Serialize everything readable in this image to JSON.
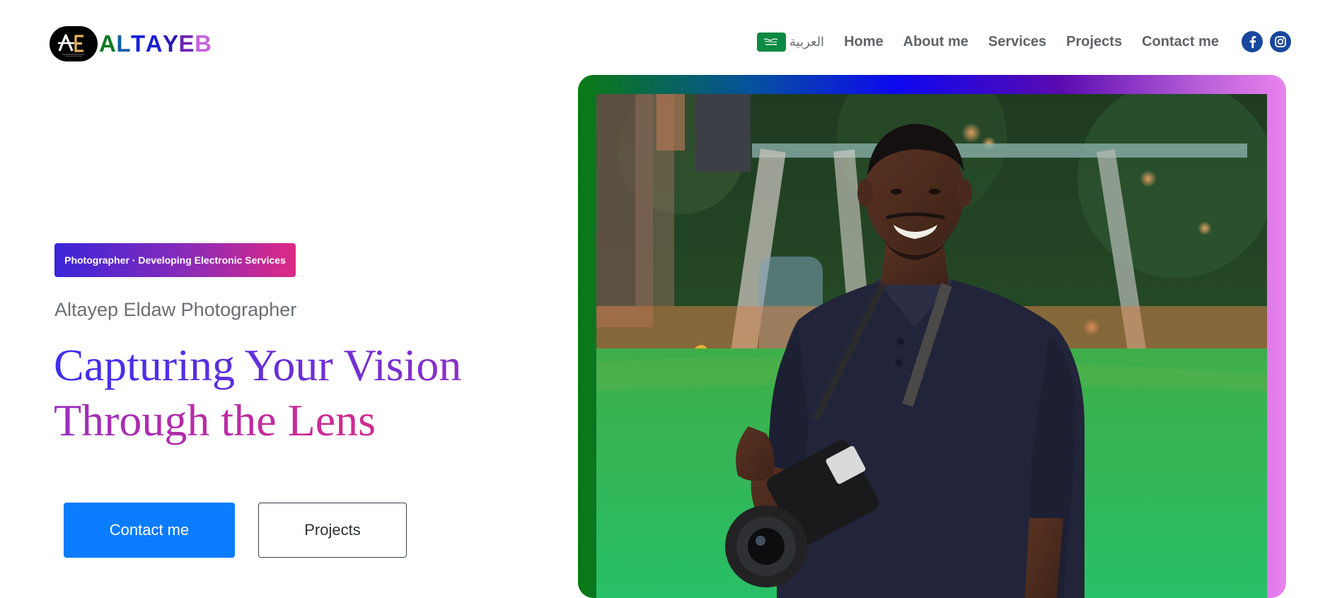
{
  "header": {
    "logo": {
      "badge_text": "AE",
      "word": "ALTAYEB",
      "word_letters": [
        {
          "ch": "A",
          "color": "#0b7a1f"
        },
        {
          "ch": "L",
          "color": "#0a5fa8"
        },
        {
          "ch": "T",
          "color": "#1620d8"
        },
        {
          "ch": "A",
          "color": "#1a1ed0"
        },
        {
          "ch": "Y",
          "color": "#2a16b8"
        },
        {
          "ch": "E",
          "color": "#6c24b4"
        },
        {
          "ch": "B",
          "color": "#c466dc"
        }
      ]
    },
    "nav": {
      "language_label": "العربية",
      "items": [
        {
          "label": "Home"
        },
        {
          "label": "About me"
        },
        {
          "label": "Services"
        },
        {
          "label": "Projects"
        },
        {
          "label": "Contact me"
        }
      ],
      "social": [
        {
          "icon": "facebook-icon"
        },
        {
          "icon": "instagram-icon"
        }
      ]
    }
  },
  "hero": {
    "tagline": "Photographer · Developing Electronic Services",
    "subtitle": "Altayep Eldaw Photographer",
    "headline_line1": "Capturing Your Vision",
    "headline_line2": "Through the Lens",
    "primary_button": "Contact me",
    "secondary_button": "Projects"
  },
  "colors": {
    "accent_blue": "#0a7cff",
    "nav_text": "#5e6368",
    "social_bg": "#17479e",
    "flag_green": "#0a8a43",
    "frame_gradient": [
      "#0a7a12",
      "#0d08ef",
      "#5a0ab0",
      "#ea82ee"
    ]
  },
  "icons": {
    "flag": "saudi-flag-icon",
    "photo": "photographer-portrait"
  }
}
